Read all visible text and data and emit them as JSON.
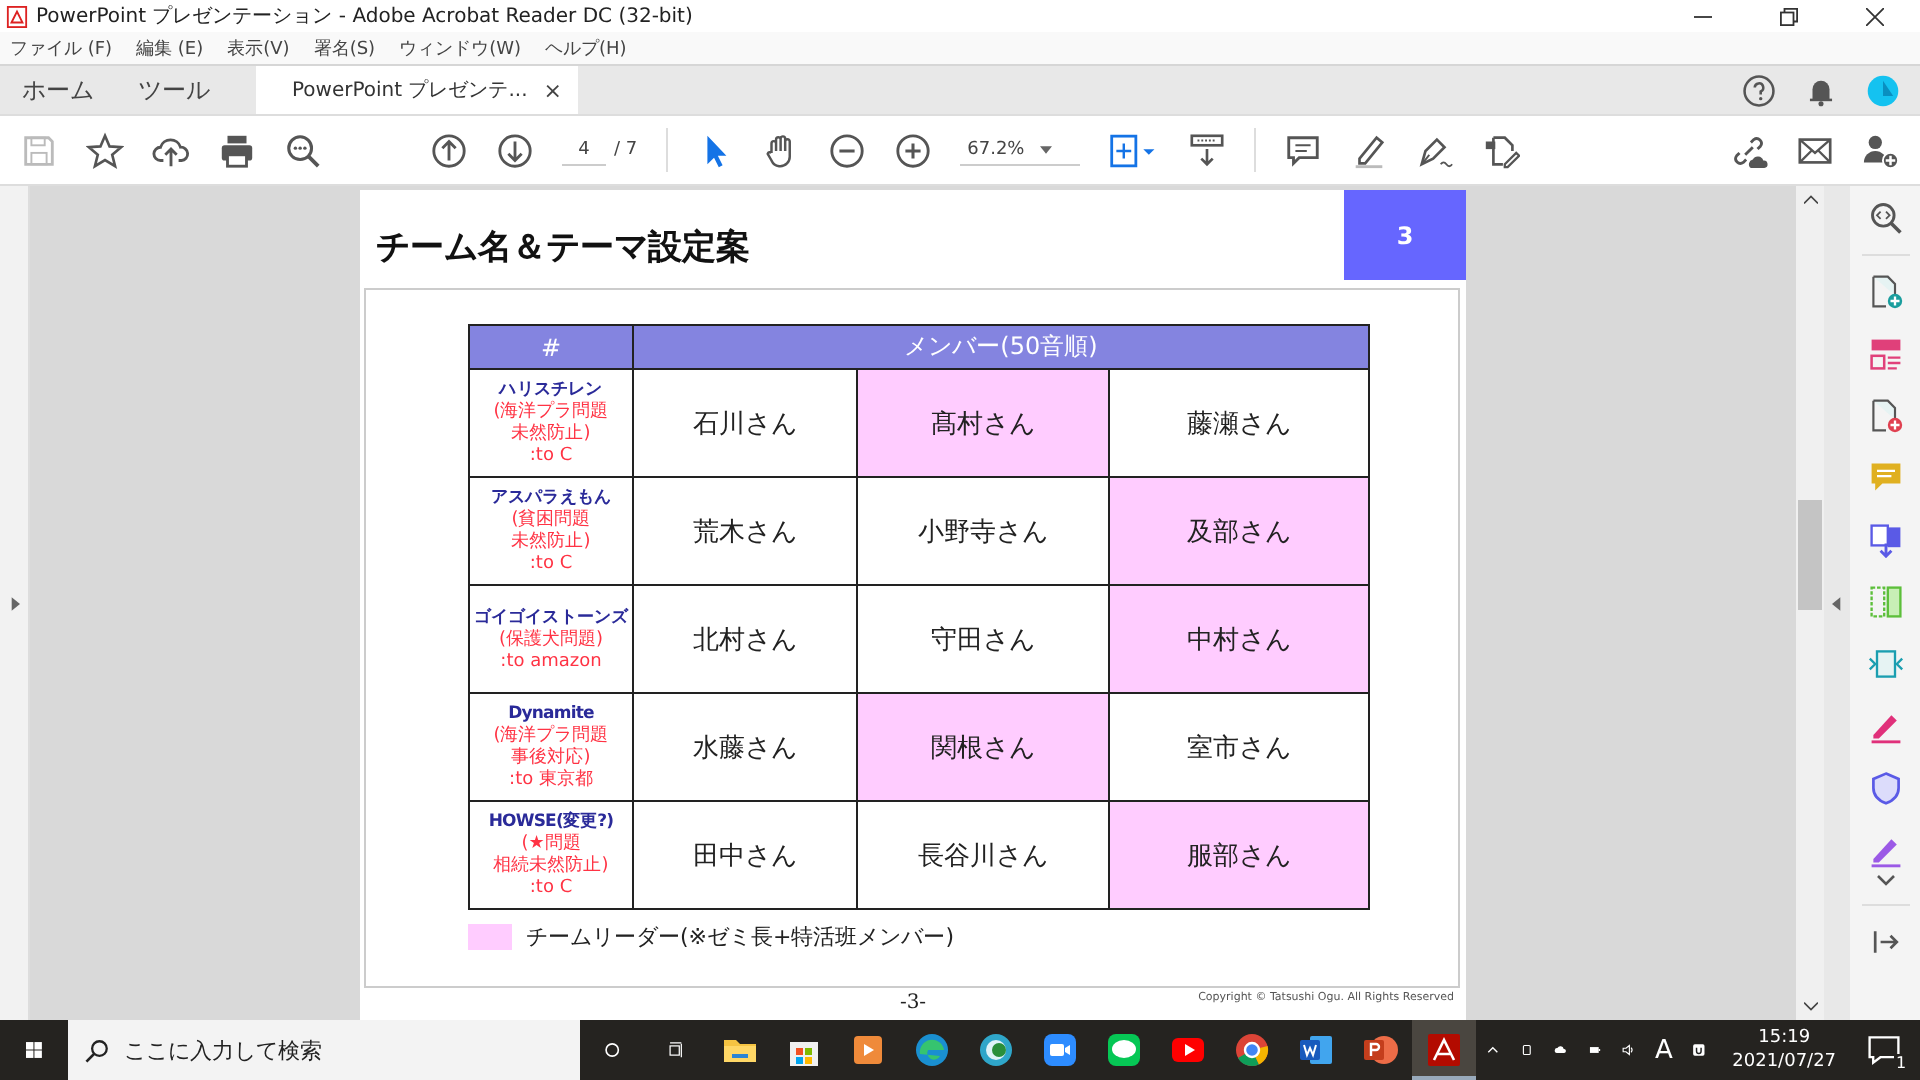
{
  "window": {
    "title": "PowerPoint プレゼンテーション - Adobe Acrobat Reader DC (32-bit)"
  },
  "menu": [
    "ファイル (F)",
    "編集 (E)",
    "表示(V)",
    "署名(S)",
    "ウィンドウ(W)",
    "ヘルプ(H)"
  ],
  "tabs": [
    {
      "label": "ホーム",
      "selected": false
    },
    {
      "label": "ツール",
      "selected": false
    },
    {
      "label": "PowerPoint プレゼンテ...",
      "selected": true,
      "close": "×"
    }
  ],
  "toolbar": {
    "page": "4",
    "page_count": "/ 7",
    "zoom": "67.2%"
  },
  "slide": {
    "title": "チーム名＆テーマ設定案",
    "number": "3",
    "table": {
      "columns": [
        "#",
        "メンバー(50音順)"
      ],
      "rows": [
        {
          "team": "ハリスチレン",
          "theme": [
            "(海洋プラ問題",
            "未然防止)",
            ":to C"
          ],
          "members": [
            {
              "name": "石川さん",
              "leader": false
            },
            {
              "name": "髙村さん",
              "leader": true
            },
            {
              "name": "藤瀬さん",
              "leader": false
            }
          ]
        },
        {
          "team": "アスパラえもん",
          "theme": [
            "(貧困問題",
            "未然防止)",
            ":to C"
          ],
          "members": [
            {
              "name": "荒木さん",
              "leader": false
            },
            {
              "name": "小野寺さん",
              "leader": false
            },
            {
              "name": "及部さん",
              "leader": true
            }
          ]
        },
        {
          "team": "ゴイゴイストーンズ",
          "theme": [
            "(保護犬問題)",
            ":to amazon"
          ],
          "members": [
            {
              "name": "北村さん",
              "leader": false
            },
            {
              "name": "守田さん",
              "leader": false
            },
            {
              "name": "中村さん",
              "leader": true
            }
          ]
        },
        {
          "team": "Dynamite",
          "theme": [
            "(海洋プラ問題",
            "事後対応)",
            ":to 東京都"
          ],
          "members": [
            {
              "name": "水藤さん",
              "leader": false
            },
            {
              "name": "関根さん",
              "leader": true
            },
            {
              "name": "室市さん",
              "leader": false
            }
          ]
        },
        {
          "team": "HOWSE(変更?)",
          "theme": [
            "(★問題",
            "相続未然防止)",
            ":to C"
          ],
          "members": [
            {
              "name": "田中さん",
              "leader": false
            },
            {
              "name": "長谷川さん",
              "leader": false
            },
            {
              "name": "服部さん",
              "leader": true
            }
          ]
        }
      ]
    },
    "legend": "チームリーダー(※ゼミ長+特活班メンバー)",
    "footer": "-3-",
    "copyright": "Copyright © Tatsushi Ogu. All Rights Reserved"
  },
  "taskbar": {
    "search": {
      "placeholder": "ここに入力して検索"
    },
    "ime": "A",
    "time": "15:19",
    "date": "2021/07/27",
    "notifications": "1"
  }
}
